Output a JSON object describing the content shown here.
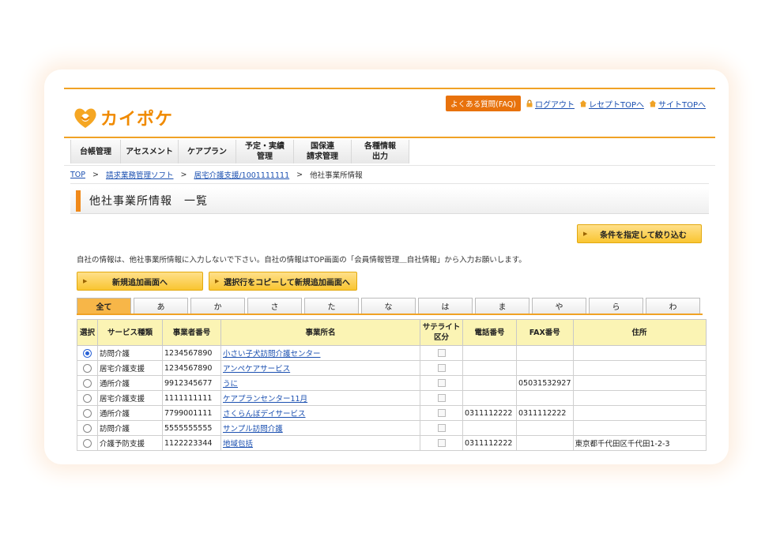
{
  "logo": {
    "text": "カイポケ"
  },
  "toplinks": {
    "faq": "よくある質問(FAQ)",
    "logout": "ログアウト",
    "receipt_top": "レセプトTOPへ",
    "site_top": "サイトTOPへ"
  },
  "nav": [
    {
      "l1": "台帳管理",
      "l2": ""
    },
    {
      "l1": "アセスメント",
      "l2": ""
    },
    {
      "l1": "ケアプラン",
      "l2": ""
    },
    {
      "l1": "予定・実績",
      "l2": "管理"
    },
    {
      "l1": "国保連",
      "l2": "請求管理"
    },
    {
      "l1": "各種情報",
      "l2": "出力"
    }
  ],
  "breadcrumb": {
    "top": "TOP",
    "sep": ">",
    "b1": "請求業務管理ソフト",
    "b2": "居宅介護支援/1001111111",
    "b3": "他社事業所情報"
  },
  "page_title": "他社事業所情報　一覧",
  "buttons": {
    "filter": "条件を指定して絞り込む",
    "new": "新規追加画面へ",
    "copy": "選択行をコピーして新規追加画面へ",
    "arrow": "▶"
  },
  "notice": "自社の情報は、他社事業所情報に入力しないで下さい。自社の情報はTOP画面の「会員情報管理＿自社情報」から入力お願いします。",
  "tabs": [
    "全て",
    "あ",
    "か",
    "さ",
    "た",
    "な",
    "は",
    "ま",
    "や",
    "ら",
    "わ"
  ],
  "active_tab": 0,
  "table": {
    "headers": {
      "select": "選択",
      "service": "サービス種類",
      "number": "事業者番号",
      "name": "事業所名",
      "satellite_1": "サテライト",
      "satellite_2": "区分",
      "phone": "電話番号",
      "fax": "FAX番号",
      "address": "住所"
    },
    "rows": [
      {
        "service": "訪問介護",
        "number": "1234567890",
        "name": "小さい子犬訪問介護センター",
        "phone": "",
        "fax": "",
        "address": "",
        "selected": true
      },
      {
        "service": "居宅介護支援",
        "number": "1234567890",
        "name": "アンペケアサービス",
        "phone": "",
        "fax": "",
        "address": "",
        "selected": false
      },
      {
        "service": "通所介護",
        "number": "9912345677",
        "name": "うに",
        "phone": "",
        "fax": "05031532927",
        "address": "",
        "selected": false
      },
      {
        "service": "居宅介護支援",
        "number": "1111111111",
        "name": "ケアプランセンター11月",
        "phone": "",
        "fax": "",
        "address": "",
        "selected": false
      },
      {
        "service": "通所介護",
        "number": "7799001111",
        "name": "さくらんぼデイサービス",
        "phone": "0311112222",
        "fax": "0311112222",
        "address": "",
        "selected": false
      },
      {
        "service": "訪問介護",
        "number": "5555555555",
        "name": "サンプル訪問介護",
        "phone": "",
        "fax": "",
        "address": "",
        "selected": false
      },
      {
        "service": "介護予防支援",
        "number": "1122223344",
        "name": "地域包括",
        "phone": "0311112222",
        "fax": "",
        "address": "東京都千代田区千代田1-2-3",
        "selected": false
      }
    ]
  },
  "colors": {
    "accent": "#f0a225",
    "button": "#f9c531",
    "header_bg": "#fbf4b4",
    "link": "#1a4fb0"
  }
}
